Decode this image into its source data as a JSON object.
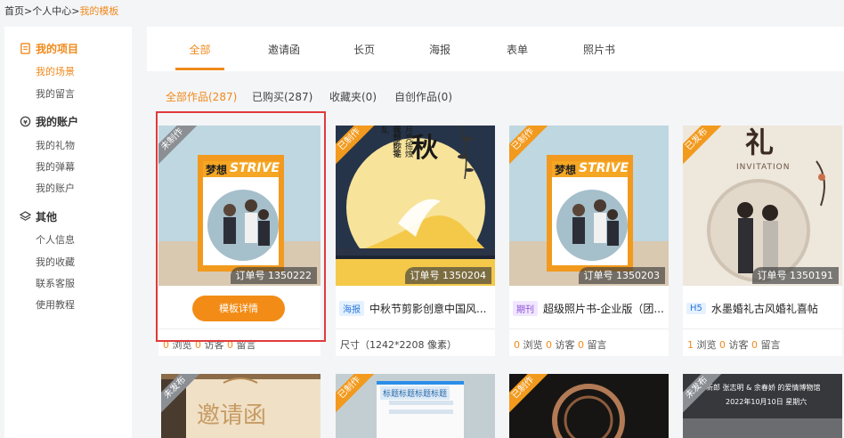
{
  "breadcrumb": {
    "home": "首页",
    "sep1": ">",
    "center": "个人中心",
    "sep2": ">",
    "current": "我的模板"
  },
  "sidebar": {
    "sections": [
      {
        "title": "我的项目",
        "icon": "document-icon",
        "items": [
          "我的场景",
          "我的留言"
        ]
      },
      {
        "title": "我的账户",
        "icon": "account-icon",
        "items": [
          "我的礼物",
          "我的弹幕",
          "我的账户"
        ]
      },
      {
        "title": "其他",
        "icon": "layers-icon",
        "items": [
          "个人信息",
          "我的收藏",
          "联系客服",
          "使用教程"
        ]
      }
    ]
  },
  "tabs": [
    "全部",
    "邀请函",
    "长页",
    "海报",
    "表单",
    "照片书"
  ],
  "filters": [
    "全部作品(287)",
    "已购买(287)",
    "收藏夹(0)",
    "自创作品(0)"
  ],
  "accent": "#f08a1c",
  "cards": [
    {
      "ribbon": "未制作",
      "order": "订单号 1350222",
      "button": "模板详情",
      "stats": [
        "0",
        "浏览",
        "0",
        "访客",
        "0",
        "留言"
      ]
    },
    {
      "ribbon": "已制作",
      "order": "订单号 1350204",
      "badge": "海报",
      "title": "中秋节剪影创意中国风...",
      "meta": "尺寸（1242*2208 像素）",
      "poster_text": "秋",
      "poster_sub": "月亮摇烛 我想你摇",
      "poster_sub2": "我剪影零乱"
    },
    {
      "ribbon": "已制作",
      "order": "订单号 1350203",
      "badge": "期刊",
      "title": "超级照片书-企业版（团...",
      "stats": [
        "0",
        "浏览",
        "0",
        "访客",
        "0",
        "留言"
      ]
    },
    {
      "ribbon": "已发布",
      "order": "订单号 1350191",
      "badge": "H5",
      "title": "水墨婚礼古风婚礼喜帖",
      "stats": [
        "1",
        "浏览",
        "0",
        "访客",
        "0",
        "留言"
      ],
      "poster_text": "礼",
      "poster_sub": "INVITATION"
    }
  ],
  "magazine": {
    "brand": "梦想",
    "word": "STRIVE"
  },
  "bottom_cards": [
    {
      "ribbon": "未发布",
      "text": "邀请函"
    },
    {
      "ribbon": "已制作",
      "text": "标题标题标题标题"
    },
    {
      "ribbon": "已制作",
      "text": ""
    },
    {
      "ribbon": "未发布",
      "text": "新郎 张志明 & 余春娇 的爱情博物馆",
      "text2": "2022年10月10日 星期六"
    }
  ]
}
